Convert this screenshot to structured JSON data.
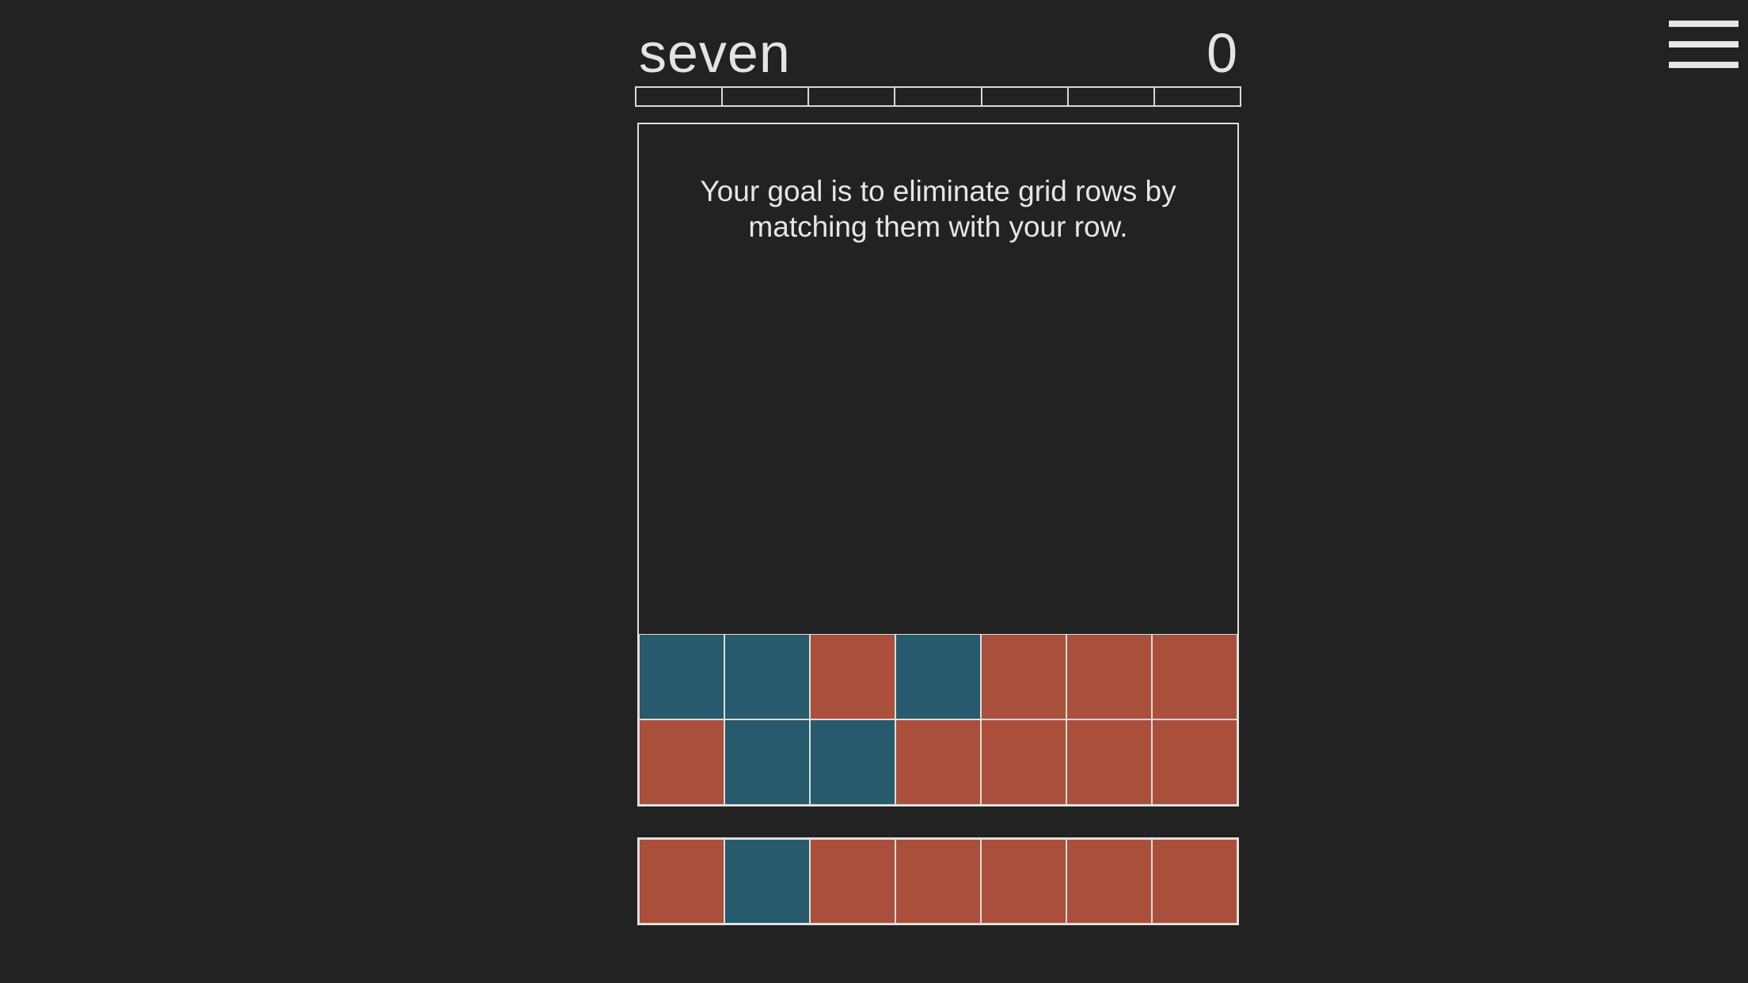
{
  "header": {
    "title": "seven",
    "score": "0"
  },
  "progress": {
    "segments": 7,
    "filled": 0
  },
  "board": {
    "instructions": "Your goal is to eliminate grid rows by matching them with your row."
  },
  "colors": {
    "background": "#222222",
    "blue": "#275a6c",
    "red": "#aa4f3b",
    "line": "#e0e0e0"
  },
  "grid_rows": [
    [
      "blue",
      "blue",
      "red",
      "blue",
      "red",
      "red",
      "red"
    ],
    [
      "red",
      "blue",
      "blue",
      "red",
      "red",
      "red",
      "red"
    ]
  ],
  "player_row": [
    "red",
    "blue",
    "red",
    "red",
    "red",
    "red",
    "red"
  ],
  "icons": {
    "menu": "hamburger-menu-icon"
  }
}
